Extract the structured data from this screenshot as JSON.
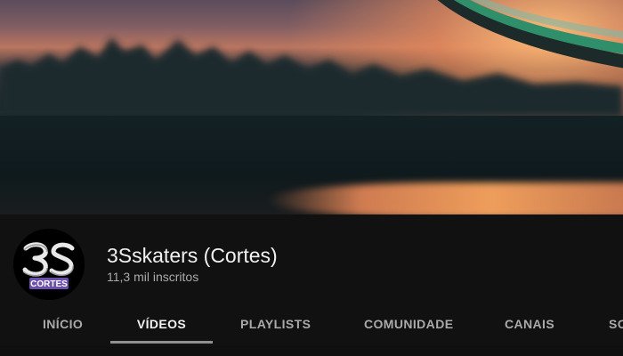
{
  "channel": {
    "name": "3Sskaters (Cortes)",
    "subscribers": "11,3 mil inscritos",
    "avatar_logo_main": "3S",
    "avatar_logo_sub": "CORTES"
  },
  "tabs": [
    {
      "label": "INÍCIO",
      "active": false
    },
    {
      "label": "VÍDEOS",
      "active": true
    },
    {
      "label": "PLAYLISTS",
      "active": false
    },
    {
      "label": "COMUNIDADE",
      "active": false
    },
    {
      "label": "CANAIS",
      "active": false
    },
    {
      "label": "SOBRE",
      "active": false
    }
  ],
  "colors": {
    "background": "#0f0f0f",
    "header_bg": "#111111",
    "title_text": "#f1f1f1",
    "secondary_text": "#aaaaaa",
    "active_underline": "#909090"
  }
}
